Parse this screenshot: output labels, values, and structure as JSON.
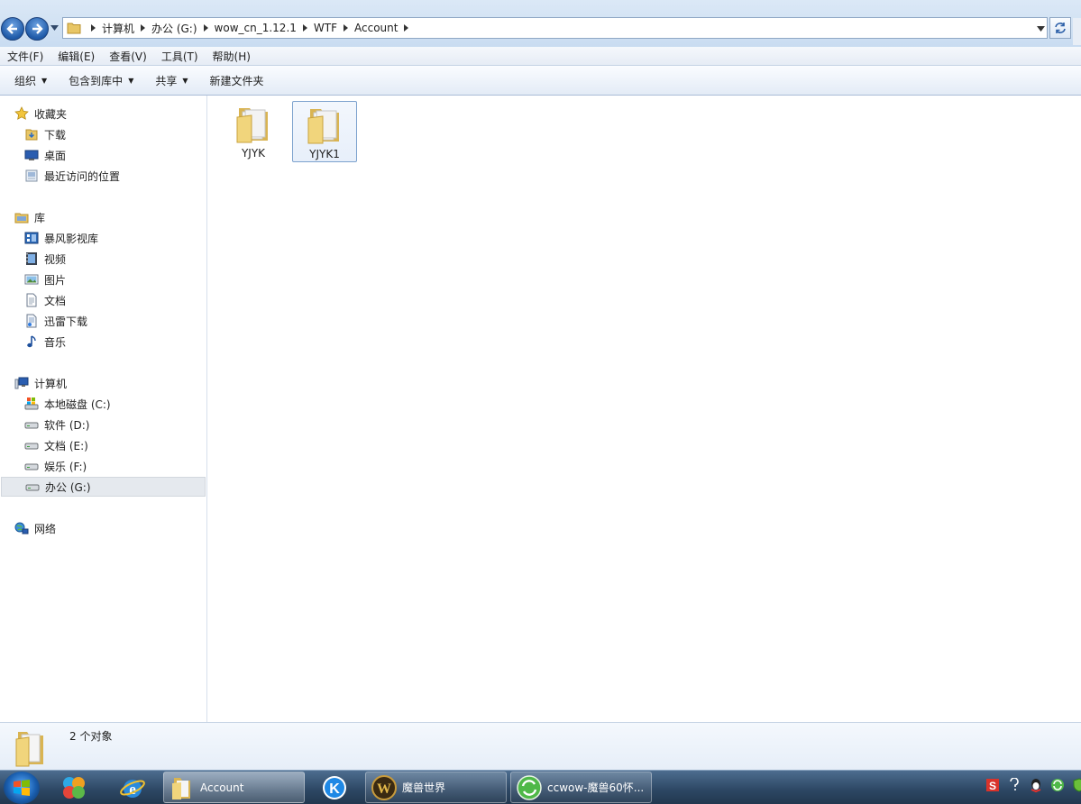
{
  "address": {
    "crumbs": [
      "计算机",
      "办公 (G:)",
      "wow_cn_1.12.1",
      "WTF",
      "Account"
    ]
  },
  "menu": {
    "file": "文件(F)",
    "edit": "编辑(E)",
    "view": "查看(V)",
    "tools": "工具(T)",
    "help": "帮助(H)"
  },
  "toolbar": {
    "organize": "组织",
    "include_library": "包含到库中",
    "share": "共享",
    "new_folder": "新建文件夹"
  },
  "sidebar": {
    "favorites": {
      "label": "收藏夹",
      "items": [
        {
          "label": "下载",
          "icon": "download-folder-icon"
        },
        {
          "label": "桌面",
          "icon": "desktop-icon"
        },
        {
          "label": "最近访问的位置",
          "icon": "recent-places-icon"
        }
      ]
    },
    "libraries": {
      "label": "库",
      "items": [
        {
          "label": "暴风影视库",
          "icon": "video-library-icon"
        },
        {
          "label": "视频",
          "icon": "video-icon"
        },
        {
          "label": "图片",
          "icon": "picture-icon"
        },
        {
          "label": "文档",
          "icon": "document-icon"
        },
        {
          "label": "迅雷下载",
          "icon": "thunder-download-icon"
        },
        {
          "label": "音乐",
          "icon": "music-icon"
        }
      ]
    },
    "computer": {
      "label": "计算机",
      "items": [
        {
          "label": "本地磁盘 (C:)",
          "icon": "system-drive-icon"
        },
        {
          "label": "软件 (D:)",
          "icon": "drive-icon"
        },
        {
          "label": "文档 (E:)",
          "icon": "drive-icon"
        },
        {
          "label": "娱乐 (F:)",
          "icon": "drive-icon"
        },
        {
          "label": "办公 (G:)",
          "icon": "drive-icon",
          "selected": true
        }
      ]
    },
    "network": {
      "label": "网络"
    }
  },
  "files": [
    {
      "name": "YJYK",
      "type": "folder"
    },
    {
      "name": "YJYK1",
      "type": "folder",
      "hovered": true
    }
  ],
  "details": {
    "count_text": "2 个对象"
  },
  "taskbar": {
    "tasks": [
      {
        "label": "Account",
        "icon": "folder-icon",
        "active": true
      },
      {
        "label": "魔兽世界",
        "icon": "wow-icon"
      },
      {
        "label": "ccwow-魔兽60怀...",
        "icon": "browser-icon"
      }
    ],
    "pinned": [
      "apps-icon",
      "ie-icon",
      "k-app-icon"
    ]
  }
}
